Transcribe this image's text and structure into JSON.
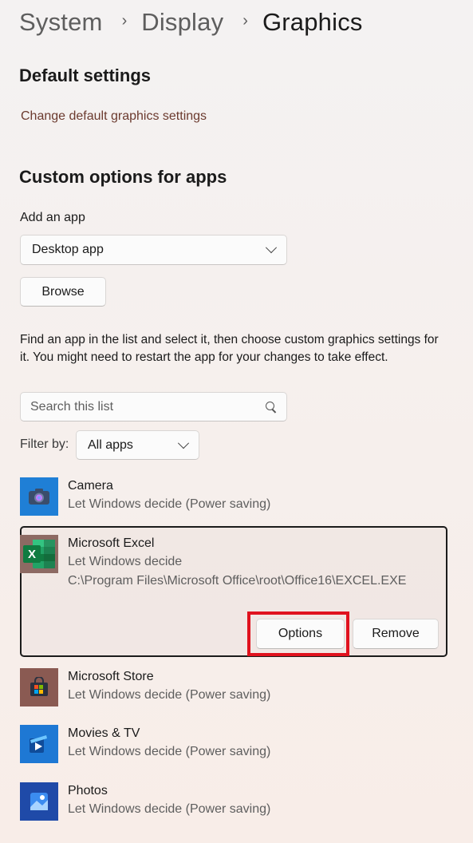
{
  "breadcrumb": {
    "items": [
      "System",
      "Display"
    ],
    "current": "Graphics"
  },
  "default_settings": {
    "title": "Default settings",
    "link": "Change default graphics settings"
  },
  "custom_options": {
    "title": "Custom options for apps",
    "add_app_label": "Add an app",
    "app_type_selected": "Desktop app",
    "browse_label": "Browse",
    "description": "Find an app in the list and select it, then choose custom graphics settings for it. You might need to restart the app for your changes to take effect.",
    "search_placeholder": "Search this list",
    "filter_label": "Filter by:",
    "filter_selected": "All apps"
  },
  "apps": [
    {
      "name": "Camera",
      "setting": "Let Windows decide (Power saving)",
      "icon": "camera-icon"
    },
    {
      "name": "Microsoft Excel",
      "setting": "Let Windows decide",
      "path": "C:\\Program Files\\Microsoft Office\\root\\Office16\\EXCEL.EXE",
      "icon": "excel-icon",
      "selected": true,
      "options_label": "Options",
      "remove_label": "Remove"
    },
    {
      "name": "Microsoft Store",
      "setting": "Let Windows decide (Power saving)",
      "icon": "store-icon"
    },
    {
      "name": "Movies & TV",
      "setting": "Let Windows decide (Power saving)",
      "icon": "movies-tv-icon"
    },
    {
      "name": "Photos",
      "setting": "Let Windows decide (Power saving)",
      "icon": "photos-icon"
    }
  ],
  "colors": {
    "highlight": "#e0121e",
    "link": "#6b3a2e",
    "excel_green": "#1e7145",
    "camera_blue": "#1f7fd6",
    "store_bg": "#8a5a52",
    "movies_blue": "#1e78d4",
    "photos_blue": "#1f4aa8"
  }
}
